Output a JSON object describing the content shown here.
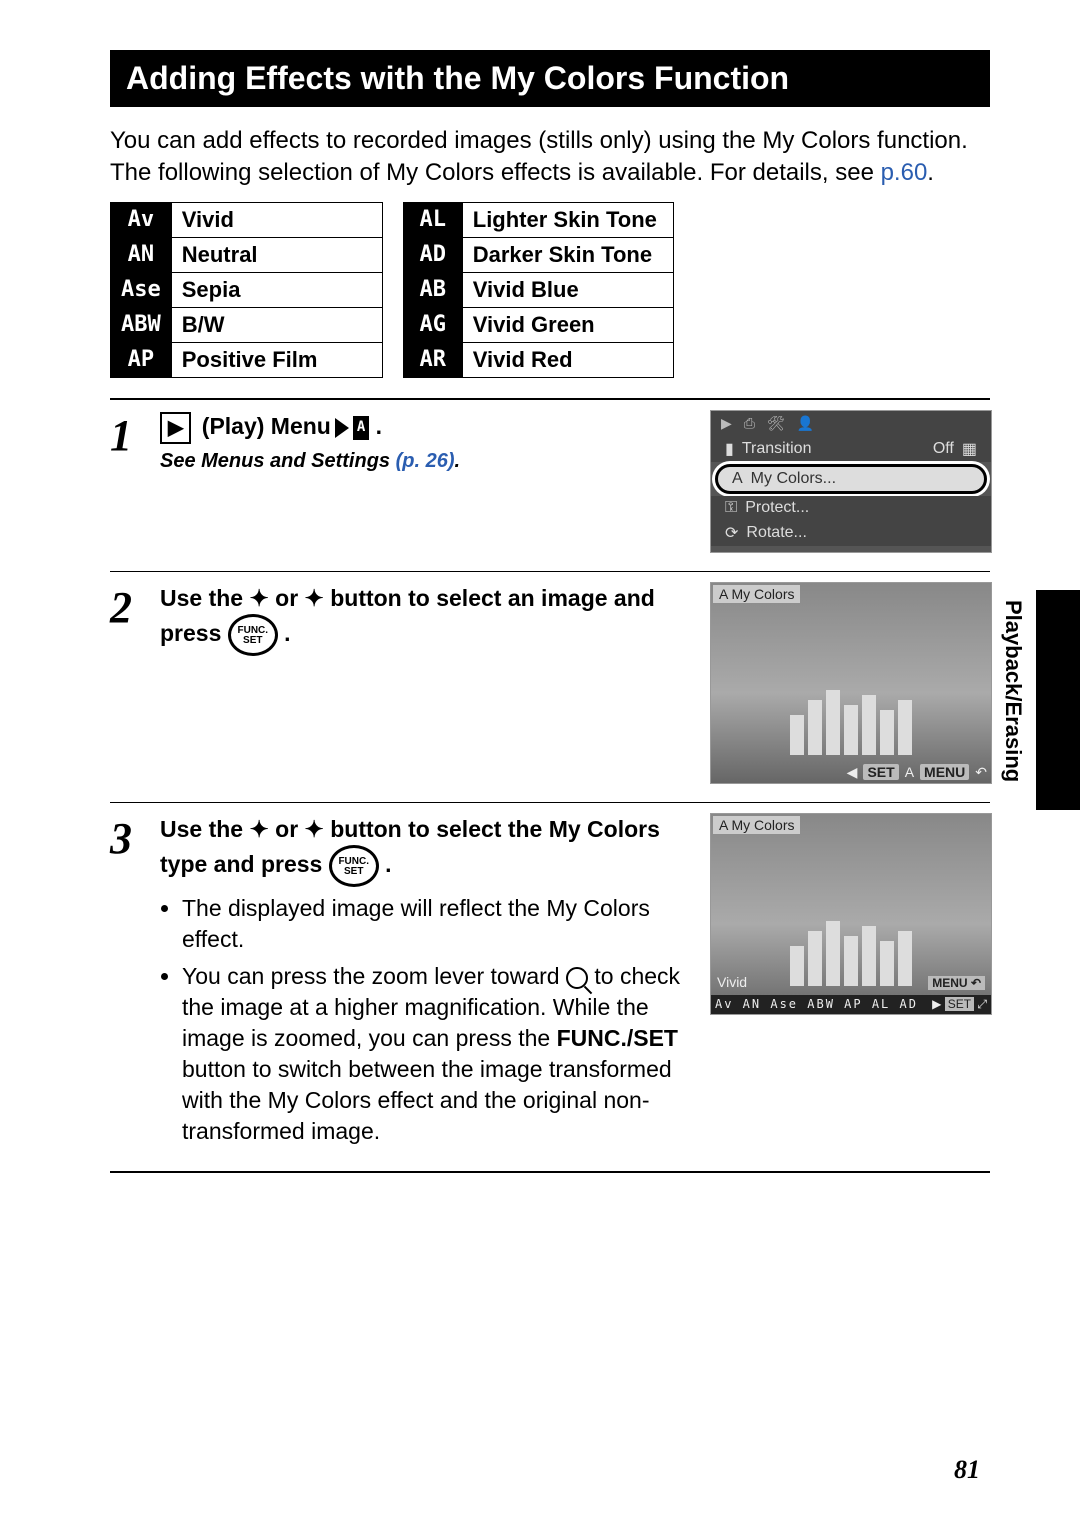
{
  "title": "Adding Effects with the My Colors Function",
  "intro_1": "You can add effects to recorded images (stills only) using the My Colors function. The following selection of My Colors effects is available. For details, see ",
  "intro_link": "p.60",
  "intro_2": ".",
  "effects_left": [
    {
      "icon": "Av",
      "label": "Vivid"
    },
    {
      "icon": "AN",
      "label": "Neutral"
    },
    {
      "icon": "Ase",
      "label": "Sepia"
    },
    {
      "icon": "ABW",
      "label": "B/W"
    },
    {
      "icon": "AP",
      "label": "Positive Film"
    }
  ],
  "effects_right": [
    {
      "icon": "AL",
      "label": "Lighter Skin Tone"
    },
    {
      "icon": "AD",
      "label": "Darker Skin Tone"
    },
    {
      "icon": "AB",
      "label": "Vivid Blue"
    },
    {
      "icon": "AG",
      "label": "Vivid Green"
    },
    {
      "icon": "AR",
      "label": "Vivid Red"
    }
  ],
  "step1": {
    "num": "1",
    "heading_pre": "(Play) Menu",
    "sub_pre": "See Menus and Settings ",
    "sub_link": "(p. 26)",
    "sub_post": ".",
    "menu_items": {
      "transition": "Transition",
      "transition_val": "Off",
      "mycolors": "My Colors...",
      "protect": "Protect...",
      "rotate": "Rotate..."
    }
  },
  "step2": {
    "num": "2",
    "heading_a": "Use the ",
    "heading_b": " or ",
    "heading_c": " button to select an image and press ",
    "heading_d": " .",
    "func_label": "FUNC.\nSET",
    "screen_label": "My Colors",
    "screen_set": "SET",
    "screen_menu": "MENU"
  },
  "step3": {
    "num": "3",
    "heading_a": "Use the ",
    "heading_b": " or ",
    "heading_c": " button to select the My Colors type and press ",
    "heading_d": " .",
    "bullet1": "The displayed image will reflect the My Colors effect.",
    "bullet2_a": "You can press the zoom lever toward ",
    "bullet2_b": " to check the image at a higher magnification. While the image is zoomed, you can press the ",
    "bullet2_bold": "FUNC./SET",
    "bullet2_c": " button to switch between the image transformed with the My Colors effect and the original non-transformed image.",
    "screen_label": "My Colors",
    "screen_effect": "Vivid",
    "screen_menu": "MENU",
    "screen_icons": "Av AN Ase ABW AP AL AD",
    "screen_set": "SET"
  },
  "side_label": "Playback/Erasing",
  "page_number": "81"
}
